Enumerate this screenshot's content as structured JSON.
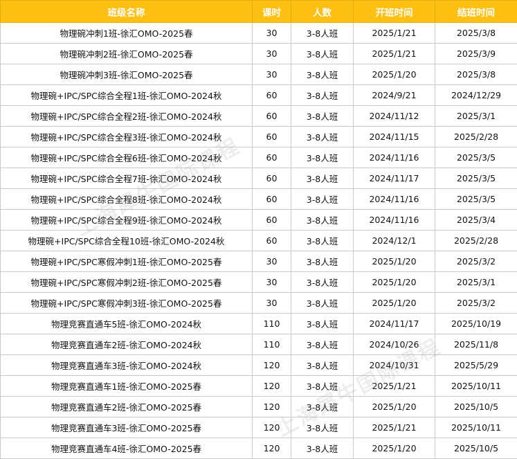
{
  "table": {
    "headers": [
      "班级名称",
      "课时",
      "人数",
      "开班时间",
      "结班时间"
    ],
    "rows": [
      [
        "物理碗冲刺1班-徐汇OMO-2025春",
        "30",
        "3-8人班",
        "2025/1/21",
        "2025/3/8"
      ],
      [
        "物理碗冲刺2班-徐汇OMO-2025春",
        "30",
        "3-8人班",
        "2025/1/21",
        "2025/3/9"
      ],
      [
        "物理碗冲刺3班-徐汇OMO-2025春",
        "30",
        "3-8人班",
        "2025/1/20",
        "2025/3/8"
      ],
      [
        "物理碗+IPC/SPC综合全程1班-徐汇OMO-2024秋",
        "60",
        "3-8人班",
        "2024/9/21",
        "2024/12/29"
      ],
      [
        "物理碗+IPC/SPC综合全程2班-徐汇OMO-2024秋",
        "60",
        "3-8人班",
        "2024/11/12",
        "2025/3/1"
      ],
      [
        "物理碗+IPC/SPC综合全程3班-徐汇OMO-2024秋",
        "60",
        "3-8人班",
        "2024/11/15",
        "2025/2/28"
      ],
      [
        "物理碗+IPC/SPC综合全程6班-徐汇OMO-2024秋",
        "60",
        "3-8人班",
        "2024/11/16",
        "2025/3/5"
      ],
      [
        "物理碗+IPC/SPC综合全程7班-徐汇OMO-2024秋",
        "60",
        "3-8人班",
        "2024/11/17",
        "2025/3/5"
      ],
      [
        "物理碗+IPC/SPC综合全程8班-徐汇OMO-2024秋",
        "60",
        "3-8人班",
        "2024/11/16",
        "2025/3/5"
      ],
      [
        "物理碗+IPC/SPC综合全程9班-徐汇OMO-2024秋",
        "60",
        "3-8人班",
        "2024/11/16",
        "2025/3/4"
      ],
      [
        "物理碗+IPC/SPC综合全程10班-徐汇OMO-2024秋",
        "60",
        "3-8人班",
        "2024/12/1",
        "2025/2/28"
      ],
      [
        "物理碗+IPC/SPC寒假冲刺1班-徐汇OMO-2025春",
        "30",
        "3-8人班",
        "2025/1/20",
        "2025/3/2"
      ],
      [
        "物理碗+IPC/SPC寒假冲刺2班-徐汇OMO-2025春",
        "30",
        "3-8人班",
        "2025/1/20",
        "2025/3/1"
      ],
      [
        "物理碗+IPC/SPC寒假冲刺3班-徐汇OMO-2025春",
        "30",
        "3-8人班",
        "2025/1/20",
        "2025/3/2"
      ],
      [
        "物理竞赛直通车5班-徐汇OMO-2024秋",
        "110",
        "3-8人班",
        "2024/11/17",
        "2025/10/19"
      ],
      [
        "物理竞赛直通车2班-徐汇OMO-2024秋",
        "110",
        "3-8人班",
        "2024/10/26",
        "2025/11/8"
      ],
      [
        "物理竞赛直通车3班-徐汇OMO-2024秋",
        "120",
        "3-8人班",
        "2024/10/31",
        "2025/5/29"
      ],
      [
        "物理竞赛直通车1班-徐汇OMO-2025春",
        "120",
        "3-8人班",
        "2025/1/21",
        "2025/10/11"
      ],
      [
        "物理竞赛直通车2班-徐汇OMO-2025春",
        "120",
        "3-8人班",
        "2025/1/20",
        "2025/10/5"
      ],
      [
        "物理竞赛直通车3班-徐汇OMO-2025春",
        "120",
        "3-8人班",
        "2025/1/21",
        "2025/10/11"
      ],
      [
        "物理竞赛直通车4班-徐汇OMO-2025春",
        "120",
        "3-8人班",
        "2025/1/20",
        "2025/10/5"
      ]
    ]
  },
  "watermark": "上海犀牛国际课程",
  "colors": {
    "header_bg": "#fdbf12",
    "header_text": "#ffffff",
    "grid": "#c9c9c9"
  }
}
